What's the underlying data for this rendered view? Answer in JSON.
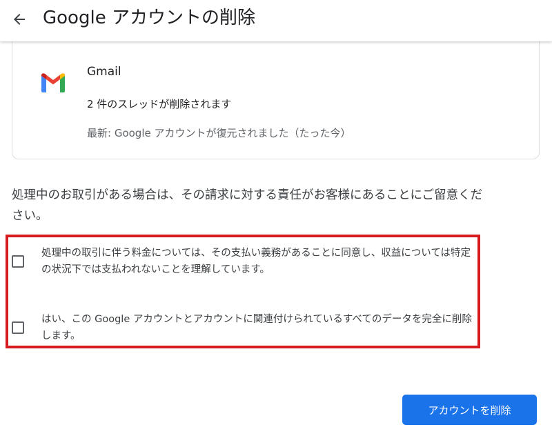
{
  "header": {
    "back_icon": "arrow-back-icon",
    "title": "Google アカウントの削除"
  },
  "service_card": {
    "icon": "gmail-logo-icon",
    "name": "Gmail",
    "line1": "2 件のスレッドが削除されます",
    "line2": "最新: Google アカウントが復元されました（たった今）"
  },
  "warning_text": "処理中のお取引がある場合は、その請求に対する責任がお客様にあることにご留意ください。",
  "checkboxes": [
    {
      "label": "処理中の取引に伴う料金については、その支払い義務があることに同意し、収益については特定の状況下では支払われないことを理解しています。",
      "checked": false
    },
    {
      "label": "はい、この Google アカウントとアカウントに関連付けられているすべてのデータを完全に削除します。",
      "checked": false
    }
  ],
  "delete_button": {
    "label": "アカウントを削除"
  },
  "colors": {
    "highlight_border": "#d71920",
    "primary_button": "#1a73e8",
    "text_primary": "#202124",
    "text_secondary": "#5f6368"
  }
}
